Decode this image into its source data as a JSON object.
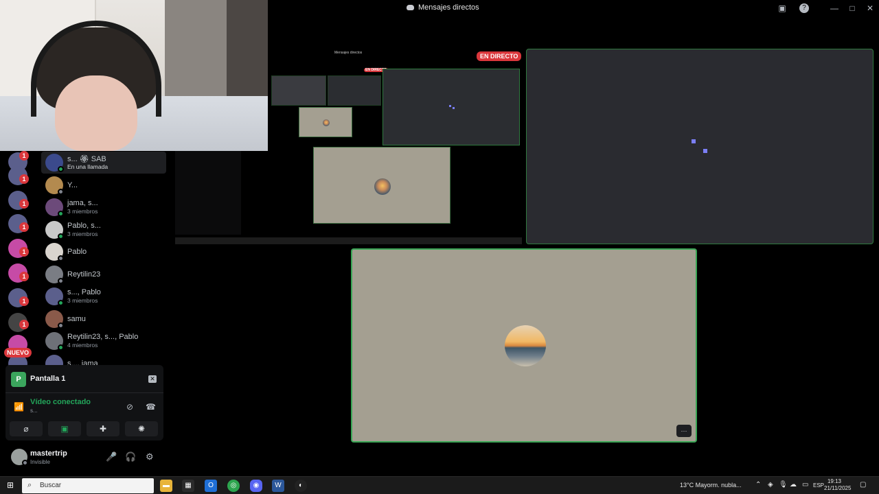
{
  "window": {
    "title": "Mensajes directos",
    "controls": {
      "minimize": "—",
      "maximize": "□",
      "close": "✕"
    }
  },
  "badges": {
    "live": "EN DIRECTO",
    "new": "NUEVO",
    "unread": "1"
  },
  "dm_list": [
    {
      "name": "s... 🏵 SAB",
      "sub": "En una llamada",
      "status": "online",
      "active": true,
      "call": true
    },
    {
      "name": "Y...",
      "sub": "",
      "status": "offline"
    },
    {
      "name": "jama, s...",
      "sub": "3 miembros",
      "status": "online"
    },
    {
      "name": "Pablo, s...",
      "sub": "3 miembros",
      "status": "online"
    },
    {
      "name": "Pablo",
      "sub": "",
      "status": "offline"
    },
    {
      "name": "Reytilin23",
      "sub": "",
      "status": "offline"
    },
    {
      "name": "s..., Pablo",
      "sub": "3 miembros",
      "status": "online"
    },
    {
      "name": "samu",
      "sub": "",
      "status": "offline"
    },
    {
      "name": "Reytilin23, s..., Pablo",
      "sub": "4 miembros",
      "status": "online"
    },
    {
      "name": "s..., jama",
      "sub": "",
      "status": "online"
    }
  ],
  "voice_panel": {
    "app_letter": "P",
    "screen_name": "Pantalla 1",
    "connection": "Vídeo conectado",
    "connection_sub": "s..."
  },
  "user_panel": {
    "username": "mastertrip",
    "status": "Invisible"
  },
  "nested": {
    "title": "Mensajes directos",
    "live": "EN DIRECTO"
  },
  "tile": {
    "more": "···"
  },
  "taskbar": {
    "search_placeholder": "Buscar",
    "weather": "13°C  Mayorm. nubla...",
    "lang": "ESP",
    "time": "19:13",
    "date": "21/11/2025"
  },
  "colors": {
    "accent_green": "#23a55a",
    "live_red": "#da373c",
    "tile_beige": "#a49f91",
    "dot_blurple": "#7b7ff5"
  }
}
